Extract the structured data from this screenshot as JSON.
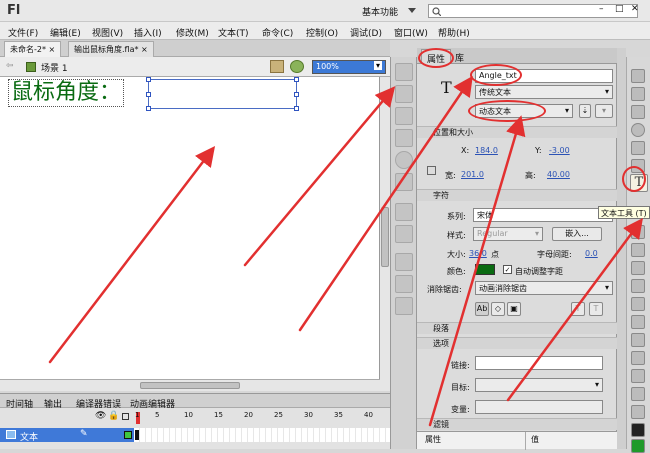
{
  "app": {
    "logo": "Fl",
    "workspace": "基本功能"
  },
  "menu": [
    "文件(F)",
    "编辑(E)",
    "视图(V)",
    "插入(I)",
    "修改(M)",
    "文本(T)",
    "命令(C)",
    "控制(O)",
    "调试(D)",
    "窗口(W)",
    "帮助(H)"
  ],
  "doc_tabs": [
    "未命名-2*",
    "输出鼠标角度.fla*"
  ],
  "editbar": {
    "scene": "场景 1",
    "zoom": "100%"
  },
  "stage": {
    "text": "鼠标角度："
  },
  "timeline": {
    "tabs": [
      "时间轴",
      "输出",
      "编译器错误",
      "动画编辑器"
    ],
    "layer": "文本",
    "frames": [
      "1",
      "5",
      "10",
      "15",
      "20",
      "25",
      "30",
      "35",
      "40"
    ]
  },
  "props": {
    "tabs": [
      "属性",
      "库"
    ],
    "instance_name": "Angle_txt",
    "text_engine": "传统文本",
    "text_type": "动态文本",
    "section_pos": "位置和大小",
    "x_label": "X:",
    "x_value": "184.0",
    "y_label": "Y:",
    "y_value": "-3.00",
    "w_label": "宽:",
    "w_value": "201.0",
    "h_label": "高:",
    "h_value": "40.00",
    "section_char": "字符",
    "family_label": "系列:",
    "family_value": "宋体",
    "style_label": "样式:",
    "style_value": "Regular",
    "embed_label": "嵌入...",
    "size_label": "大小:",
    "size_value": "36.0",
    "size_unit": "点",
    "spacing_label": "字母间距:",
    "spacing_value": "0.0",
    "color_label": "颜色:",
    "color_value": "#0a6b12",
    "autokern_label": "自动调整字距",
    "aa_label": "消除锯齿:",
    "aa_value": "动画消除锯齿",
    "section_para": "段落",
    "section_option": "选项",
    "link_label": "链接:",
    "target_label": "目标:",
    "var_label": "变量:",
    "section_filter": "滤镜",
    "filter_col1": "属性",
    "filter_col2": "值"
  },
  "tooltip": "文本工具 (T)",
  "colors": {
    "annotation": "#e23030",
    "text_color": "#0a6b12",
    "accent": "#2b52b5"
  }
}
